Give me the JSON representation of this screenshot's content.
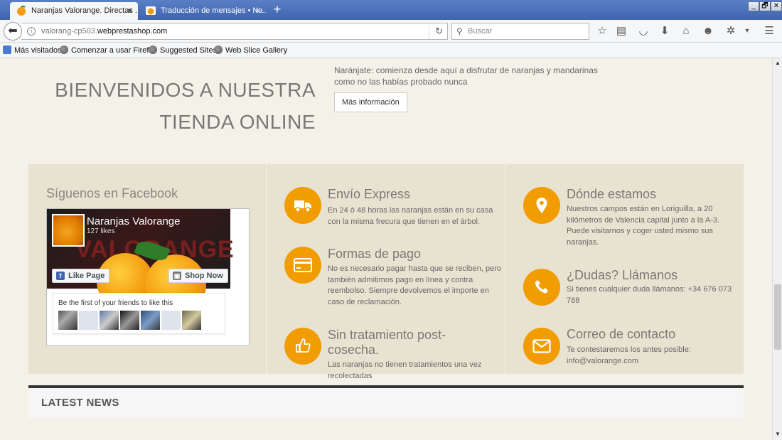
{
  "browser": {
    "tabs": [
      {
        "title": "Naranjas Valorange. Directas ...",
        "close": "×"
      },
      {
        "title": "Traducción de mensajes • Na...",
        "close": "×"
      }
    ],
    "new_tab": "+",
    "window_buttons": [
      "_",
      "🗗",
      "✕"
    ],
    "url": {
      "prefix": "valorang-cp503.",
      "host": "webprestashop.com"
    },
    "search_placeholder": "Buscar",
    "toolbar_icons": [
      "star-icon",
      "reading-list-icon",
      "pocket-icon",
      "download-icon",
      "home-icon",
      "chat-icon",
      "extension-icon",
      "overflow-icon",
      "menu-icon"
    ],
    "bookmarks": [
      "Más visitados",
      "Comenzar a usar Firef...",
      "Suggested Sites",
      "Web Slice Gallery"
    ]
  },
  "page": {
    "welcome_line1": "BIENVENIDOS A NUESTRA",
    "welcome_line2": "TIENDA ONLINE",
    "intro_text": "Naránjate: comienza desde aquí a disfrutar de naranjas y mandarinas como no las habías probado nunca",
    "more_info_button": "Más información",
    "facebook": {
      "title": "Síguenos en Facebook",
      "page_name": "Naranjas Valorange",
      "likes": "127 likes",
      "like_button": "Like Page",
      "shop_button": "Shop Now",
      "cover_text": "VALORANGE",
      "friends_text": "Be the first of your friends to like this"
    },
    "features": [
      {
        "icon": "truck-icon",
        "title": "Envío Express",
        "text": "En 24 ó 48 horas las naranjas están en su casa con la misma frecura que tienen en el árbol."
      },
      {
        "icon": "credit-card-icon",
        "title": "Formas de pago",
        "text": "No es necesario pagar hasta que se reciben, pero también admitimos pago en línea y contra reembolso. Siempre devolvemos el importe en caso de reclamación."
      },
      {
        "icon": "thumbs-up-icon",
        "title": "Sin tratamiento post-cosecha.",
        "text": "Las naranjas no tienen tratamientos una vez recolectadas"
      },
      {
        "icon": "location-pin-icon",
        "title": "Dónde estamos",
        "text": "Nuestros campos están en Loriguilla, a 20 kilómetros de Valencia capital junto a la A-3. Puede visitarnos y coger usted mismo sus naranjas."
      },
      {
        "icon": "phone-icon",
        "title": "¿Dudas? Llámanos",
        "text": "Si tienes cualquier duda llámanos: +34 676 073 788"
      },
      {
        "icon": "envelope-icon",
        "title": "Correo de contacto",
        "text": "Te contestaremos los antes posible: info@valorange.com"
      }
    ],
    "latest_news": "LATEST NEWS"
  },
  "colors": {
    "accent": "#f19c00",
    "panel": "#e8e3d1",
    "page_bg": "#f4f1e8"
  }
}
